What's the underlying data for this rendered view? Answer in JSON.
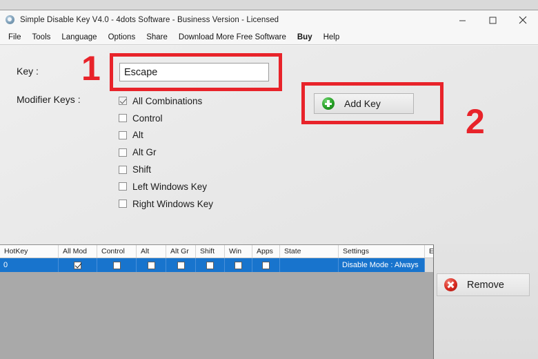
{
  "window": {
    "title": "Simple Disable Key V4.0 - 4dots Software - Business Version - Licensed",
    "icon": "app-icon",
    "controls": {
      "minimize": "minimize-icon",
      "maximize": "maximize-icon",
      "close": "close-icon"
    }
  },
  "menubar": {
    "items": [
      {
        "label": "File",
        "bold": false
      },
      {
        "label": "Tools",
        "bold": false
      },
      {
        "label": "Language",
        "bold": false
      },
      {
        "label": "Options",
        "bold": false
      },
      {
        "label": "Share",
        "bold": false
      },
      {
        "label": "Download More Free Software",
        "bold": false
      },
      {
        "label": "Buy",
        "bold": true
      },
      {
        "label": "Help",
        "bold": false
      }
    ]
  },
  "form": {
    "key_label": "Key :",
    "key_value": "Escape",
    "key_placeholder": "",
    "modifier_label": "Modifier Keys :",
    "modifiers": [
      {
        "label": "All Combinations",
        "checked": true
      },
      {
        "label": "Control",
        "checked": false
      },
      {
        "label": "Alt",
        "checked": false
      },
      {
        "label": "Alt Gr",
        "checked": false
      },
      {
        "label": "Shift",
        "checked": false
      },
      {
        "label": "Left Windows Key",
        "checked": false
      },
      {
        "label": "Right Windows Key",
        "checked": false
      }
    ],
    "add_key_label": "Add Key",
    "add_key_icon": "green-plus-icon"
  },
  "annotations": [
    {
      "text": "1",
      "color": "#e8232a"
    },
    {
      "text": "2",
      "color": "#e8232a"
    }
  ],
  "table": {
    "columns": [
      {
        "label": "HotKey",
        "width": 85
      },
      {
        "label": "All Mod",
        "width": 56
      },
      {
        "label": "Control",
        "width": 57
      },
      {
        "label": "Alt",
        "width": 43
      },
      {
        "label": "Alt Gr",
        "width": 43
      },
      {
        "label": "Shift",
        "width": 42
      },
      {
        "label": "Win",
        "width": 40
      },
      {
        "label": "Apps",
        "width": 40
      },
      {
        "label": "State",
        "width": 85
      },
      {
        "label": "Settings",
        "width": 125
      },
      {
        "label": "Ed",
        "width": 30
      }
    ],
    "rows": [
      {
        "selected": true,
        "hotkey": "0",
        "all_mod": true,
        "control": false,
        "alt": false,
        "alt_gr": false,
        "shift": false,
        "win": false,
        "apps": false,
        "state": "",
        "settings": "Disable Mode : Always",
        "edit": ""
      }
    ]
  },
  "remove": {
    "label": "Remove",
    "icon": "red-x-icon"
  },
  "colors": {
    "annotation_red": "#e8232a",
    "selection_blue": "#1874cd",
    "table_background": "#a9a9a9",
    "panel_background": "#eaeaea"
  }
}
